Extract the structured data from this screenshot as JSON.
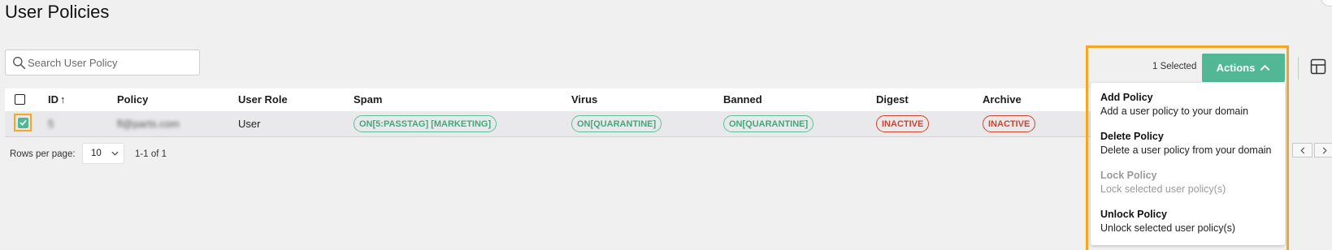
{
  "page": {
    "title": "User Policies"
  },
  "search": {
    "placeholder": "Search User Policy",
    "value": ""
  },
  "toolbar": {
    "selected_text": "1 Selected",
    "actions_label": "Actions"
  },
  "table": {
    "columns": [
      {
        "key": "id",
        "label": "ID",
        "sort": "asc"
      },
      {
        "key": "policy",
        "label": "Policy"
      },
      {
        "key": "user_role",
        "label": "User Role"
      },
      {
        "key": "spam",
        "label": "Spam"
      },
      {
        "key": "virus",
        "label": "Virus"
      },
      {
        "key": "banned",
        "label": "Banned"
      },
      {
        "key": "digest",
        "label": "Digest"
      },
      {
        "key": "archive",
        "label": "Archive"
      }
    ],
    "rows": [
      {
        "selected": true,
        "id": "5",
        "policy": "fl@parts.com",
        "user_role": "User",
        "spam": "ON[5:PASSTAG] [MARKETING]",
        "virus": "ON[QUARANTINE]",
        "banned": "ON[QUARANTINE]",
        "digest": "INACTIVE",
        "archive": "INACTIVE"
      }
    ]
  },
  "pagination": {
    "rows_per_page_label": "Rows per page:",
    "rows_per_page": "10",
    "range": "1-1 of 1"
  },
  "actions_menu": {
    "items": [
      {
        "title": "Add Policy",
        "description": "Add a user policy to your domain",
        "disabled": false
      },
      {
        "title": "Delete Policy",
        "description": "Delete a user policy from your domain",
        "disabled": false
      },
      {
        "title": "Lock Policy",
        "description": "Lock selected user policy(s)",
        "disabled": true
      },
      {
        "title": "Unlock Policy",
        "description": "Unlock selected user policy(s)",
        "disabled": false
      }
    ]
  },
  "colors": {
    "accent": "#52b795",
    "status_on": "#3fa97d",
    "status_inactive": "#d0432b",
    "highlight": "#f5a623"
  },
  "icons": [
    "search-icon",
    "sort-arrow-up-icon",
    "chevron-up-icon",
    "columns-icon",
    "chevron-down-icon",
    "chevron-left-icon",
    "chevron-right-icon",
    "checkmark-icon"
  ]
}
